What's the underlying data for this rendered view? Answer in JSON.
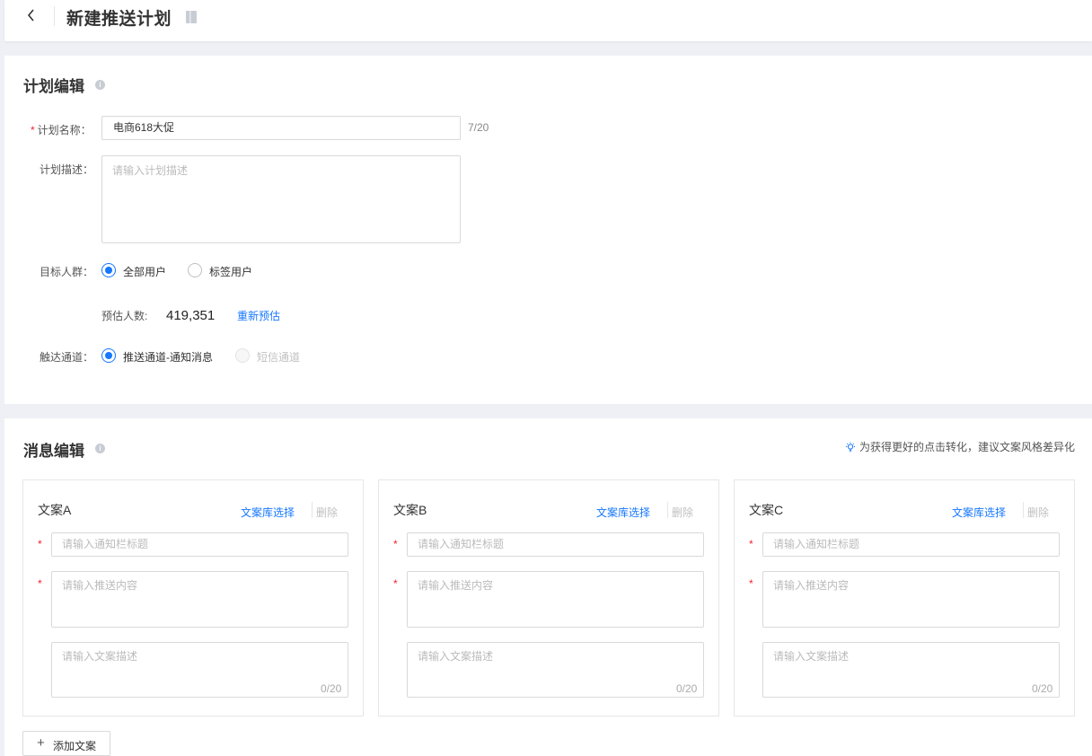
{
  "header": {
    "title": "新建推送计划",
    "back_icon": "chevron-left-icon",
    "doc_icon": "document-icon"
  },
  "plan": {
    "section_title": "计划编辑",
    "name_label": "计划名称：",
    "name_value": "电商618大促",
    "name_counter": "7/20",
    "desc_label": "计划描述：",
    "desc_placeholder": "请输入计划描述",
    "target_label": "目标人群：",
    "target_options": [
      "全部用户",
      "标签用户"
    ],
    "target_selected": "全部用户",
    "estimate_label": "预估人数:",
    "estimate_value": "419,351",
    "re_estimate": "重新预估",
    "channel_label": "触达通道：",
    "channel_options": [
      "推送通道-通知消息",
      "短信通道"
    ],
    "channel_selected": "推送通道-通知消息"
  },
  "message": {
    "section_title": "消息编辑",
    "hint": "为获得更好的点击转化，建议文案风格差异化",
    "cards": [
      {
        "title": "文案A",
        "library_link": "文案库选择",
        "delete": "删除",
        "title_placeholder": "请输入通知栏标题",
        "content_placeholder": "请输入推送内容",
        "desc_placeholder": "请输入文案描述",
        "desc_counter": "0/20"
      },
      {
        "title": "文案B",
        "library_link": "文案库选择",
        "delete": "删除",
        "title_placeholder": "请输入通知栏标题",
        "content_placeholder": "请输入推送内容",
        "desc_placeholder": "请输入文案描述",
        "desc_counter": "0/20"
      },
      {
        "title": "文案C",
        "library_link": "文案库选择",
        "delete": "删除",
        "title_placeholder": "请输入通知栏标题",
        "content_placeholder": "请输入推送内容",
        "desc_placeholder": "请输入文案描述",
        "desc_counter": "0/20"
      }
    ],
    "add_button": "添加文案"
  },
  "colors": {
    "accent": "#1677ff",
    "required": "#f5222d",
    "background": "#eef0f5"
  }
}
